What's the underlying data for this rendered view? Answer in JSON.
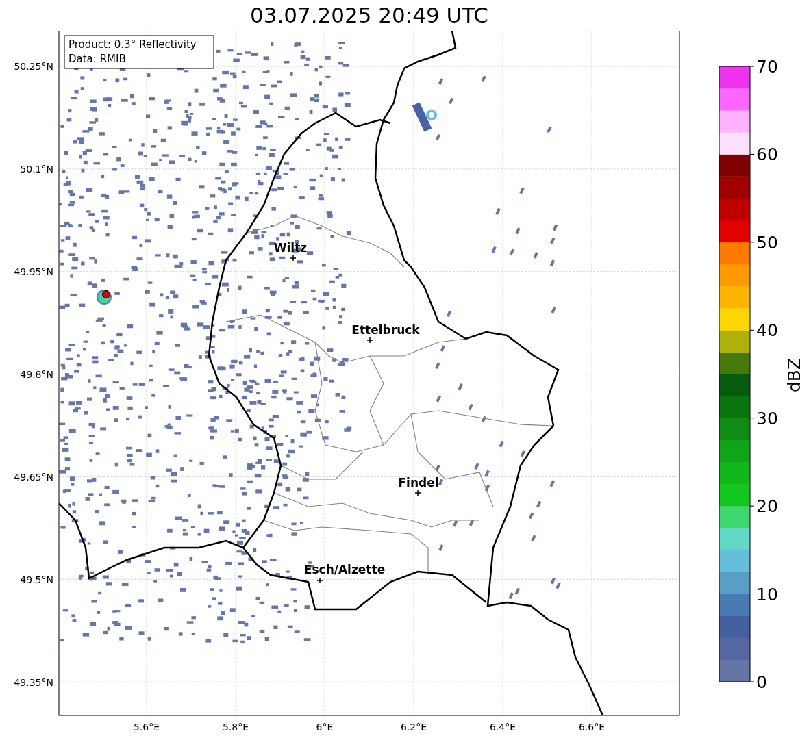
{
  "title": "03.07.2025 20:49 UTC",
  "info_box": [
    "Product: 0.3° Reflectivity",
    "Data: RMIB"
  ],
  "y_ticks": [
    "50.25°N",
    "50.1°N",
    "49.95°N",
    "49.8°N",
    "49.65°N",
    "49.5°N",
    "49.35°N"
  ],
  "x_ticks": [
    "5.6°E",
    "5.8°E",
    "6°E",
    "6.2°E",
    "6.4°E",
    "6.6°E"
  ],
  "cities": [
    {
      "name": "Wiltz"
    },
    {
      "name": "Ettelbruck"
    },
    {
      "name": "Findel"
    },
    {
      "name": "Esch/Alzette"
    }
  ],
  "colorbar": {
    "label": "dBZ",
    "ticks": [
      "70",
      "60",
      "50",
      "40",
      "30",
      "20",
      "10",
      "0"
    ],
    "segments": [
      {
        "color": "#6575a6"
      },
      {
        "color": "#5567a0"
      },
      {
        "color": "#4560a0"
      },
      {
        "color": "#4a7ab4"
      },
      {
        "color": "#5a9ec6"
      },
      {
        "color": "#64c0da"
      },
      {
        "color": "#62d8c4"
      },
      {
        "color": "#3ed66f"
      },
      {
        "color": "#12c81e"
      },
      {
        "color": "#12b81a"
      },
      {
        "color": "#10a418"
      },
      {
        "color": "#0e8c14"
      },
      {
        "color": "#0a7410"
      },
      {
        "color": "#065c0c"
      },
      {
        "color": "#46780a"
      },
      {
        "color": "#b0b00a"
      },
      {
        "color": "#ffd700"
      },
      {
        "color": "#ffb400"
      },
      {
        "color": "#ff9a00"
      },
      {
        "color": "#ff7a00"
      },
      {
        "color": "#e00000"
      },
      {
        "color": "#c00000"
      },
      {
        "color": "#a00000"
      },
      {
        "color": "#800000"
      },
      {
        "color": "#ffe0ff"
      },
      {
        "color": "#ffb0ff"
      },
      {
        "color": "#ff66ff"
      },
      {
        "color": "#ee33ee"
      }
    ]
  }
}
